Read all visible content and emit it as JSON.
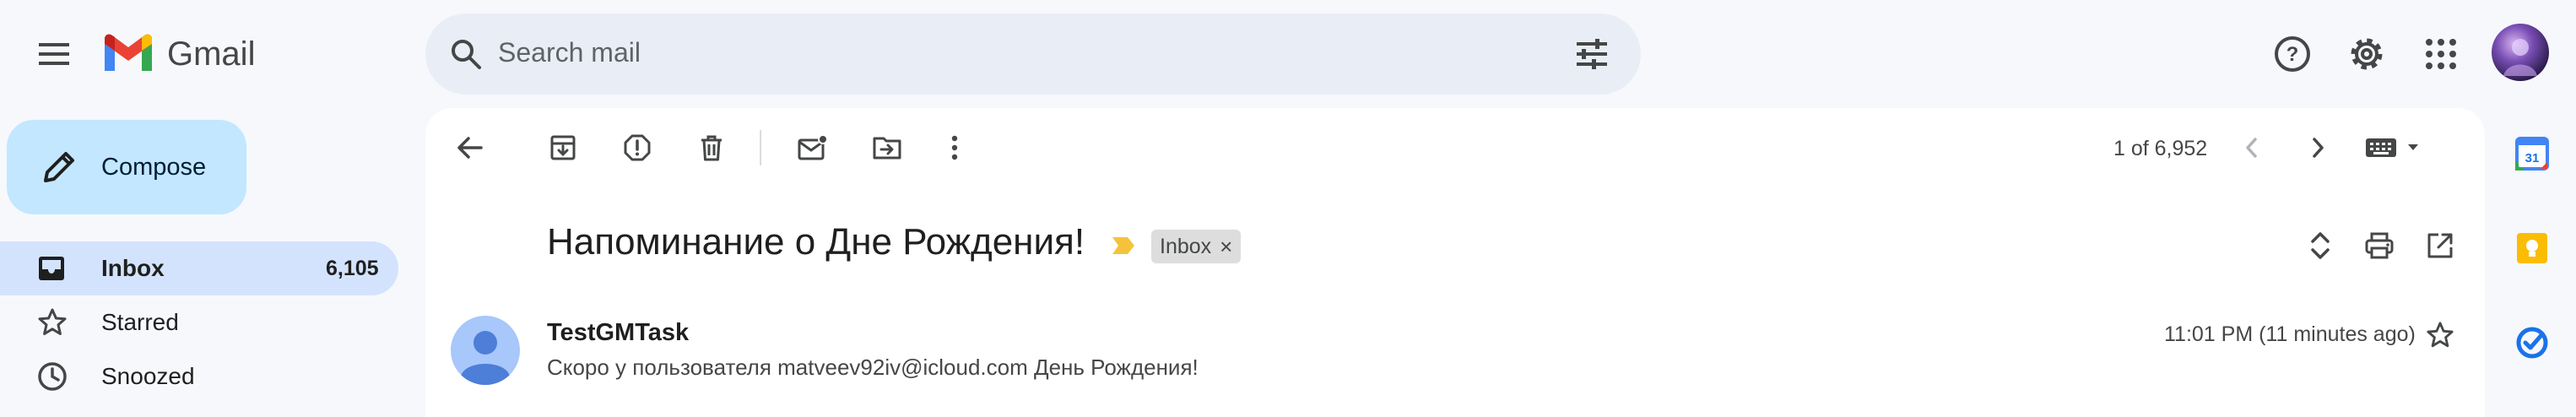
{
  "app": {
    "name": "Gmail"
  },
  "search": {
    "placeholder": "Search mail"
  },
  "compose": {
    "label": "Compose"
  },
  "nav": [
    {
      "label": "Inbox",
      "count": "6,105"
    },
    {
      "label": "Starred"
    },
    {
      "label": "Snoozed"
    }
  ],
  "toolbar": {
    "pagination": "1 of 6,952"
  },
  "email": {
    "subject": "Напоминание о Дне Рождения!",
    "label_chip": "Inbox",
    "label_chip_close": "×",
    "sender": "TestGMTask",
    "time": "11:01 PM (11 minutes ago)",
    "preview": "Скоро у пользователя matveev92iv@icloud.com День Рождения!"
  },
  "right_rail": {
    "calendar_day": "31"
  },
  "icons": {
    "menu": "menu-icon",
    "search": "search-icon",
    "filter": "tune-icon",
    "help": "help-icon",
    "settings": "gear-icon",
    "apps": "apps-grid-icon",
    "back": "arrow-back-icon",
    "archive": "archive-icon",
    "spam": "report-spam-icon",
    "delete": "trash-icon",
    "mark_unread": "mark-unread-icon",
    "move_to": "move-to-folder-icon",
    "more": "more-vert-icon",
    "prev": "chevron-left-icon",
    "next": "chevron-right-icon",
    "keyboard": "keyboard-icon",
    "expand": "unfold-icon",
    "print": "print-icon",
    "open_new": "open-in-new-icon",
    "star": "star-icon",
    "importance": "importance-marker-icon"
  },
  "colors": {
    "background": "#f6f8fc",
    "compose_bg": "#c2e7ff",
    "nav_active_bg": "#d3e3fd",
    "search_bg": "#e9eef6",
    "importance_marker": "#f5c33b",
    "avatar_bg": "#a8c7fa",
    "avatar_fg": "#4d7ed8"
  }
}
